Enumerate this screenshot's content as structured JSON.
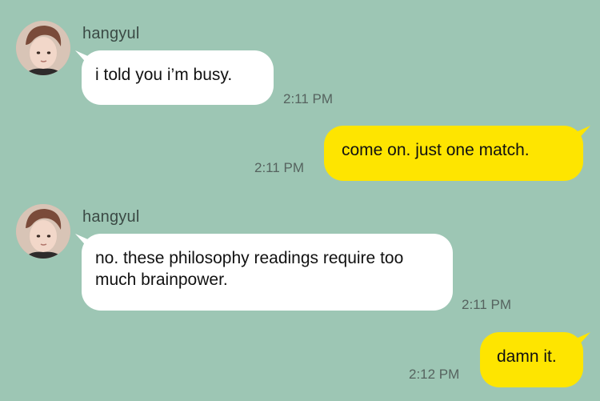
{
  "theme": {
    "background": "#9dc6b4",
    "incoming_bubble": "#ffffff",
    "outgoing_bubble": "#fee500"
  },
  "messages": [
    {
      "direction": "incoming",
      "sender": "hangyul",
      "text": "i told you i’m busy.",
      "time": "2:11 PM"
    },
    {
      "direction": "outgoing",
      "text": "come on. just one match.",
      "time": "2:11 PM"
    },
    {
      "direction": "incoming",
      "sender": "hangyul",
      "text": "no. these philosophy readings require too much brainpower.",
      "time": "2:11 PM"
    },
    {
      "direction": "outgoing",
      "text": "damn it.",
      "time": "2:12 PM"
    }
  ]
}
